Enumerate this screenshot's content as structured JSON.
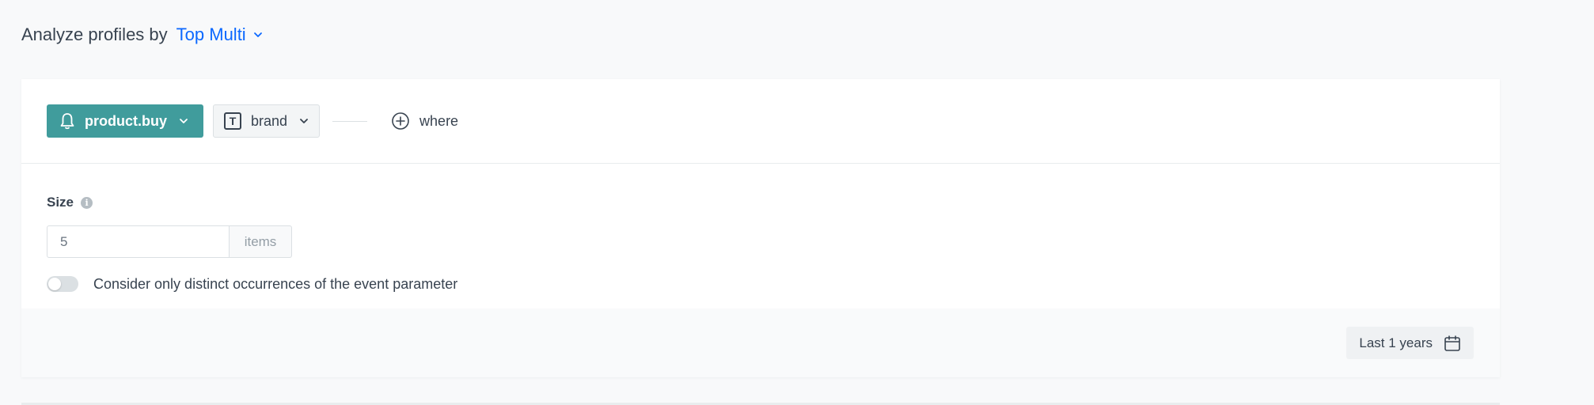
{
  "header": {
    "title": "Analyze profiles by",
    "mode": "Top Multi"
  },
  "filter": {
    "event": "product.buy",
    "parameter_type_icon": "T",
    "parameter": "brand",
    "where": "where"
  },
  "size": {
    "label": "Size",
    "info_icon": "i",
    "value": "5",
    "unit": "items"
  },
  "distinct_toggle": {
    "label": "Consider only distinct occurrences of the event parameter",
    "enabled": false
  },
  "date_range": {
    "label": "Last 1 years"
  },
  "colors": {
    "accent": "#0b68ff",
    "event_button": "#409c9c"
  }
}
